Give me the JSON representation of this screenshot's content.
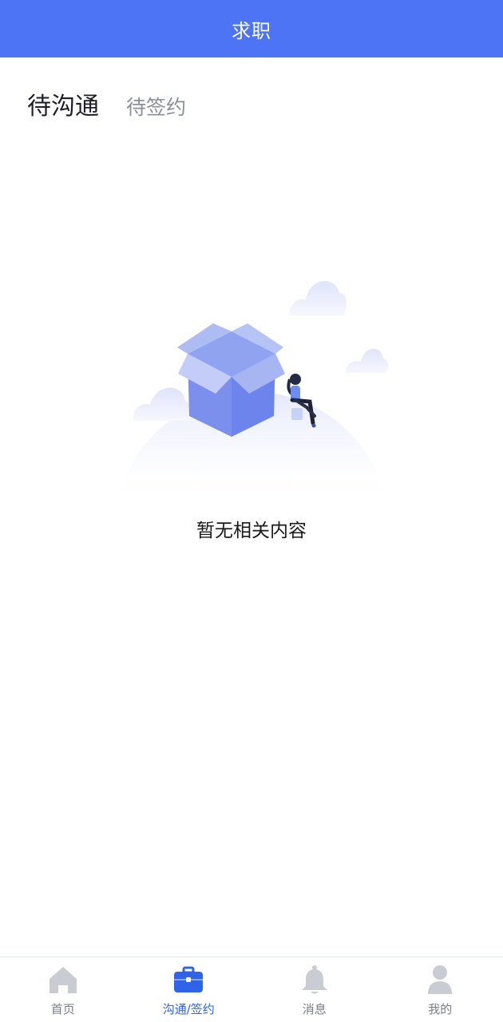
{
  "header": {
    "title": "求职"
  },
  "tabs": [
    {
      "label": "待沟通",
      "active": true
    },
    {
      "label": "待签约",
      "active": false
    }
  ],
  "empty_state": {
    "message": "暂无相关内容"
  },
  "bottom_nav": {
    "items": [
      {
        "label": "首页",
        "icon": "home-icon",
        "active": false
      },
      {
        "label": "沟通/签约",
        "icon": "briefcase-icon",
        "active": true
      },
      {
        "label": "消息",
        "icon": "bell-icon",
        "active": false
      },
      {
        "label": "我的",
        "icon": "user-icon",
        "active": false
      }
    ]
  },
  "colors": {
    "brand": "#4c74f5",
    "active_nav": "#2f63e8",
    "inactive_nav_icon": "#c9ccd3",
    "inactive_text": "#8a8f9a"
  }
}
